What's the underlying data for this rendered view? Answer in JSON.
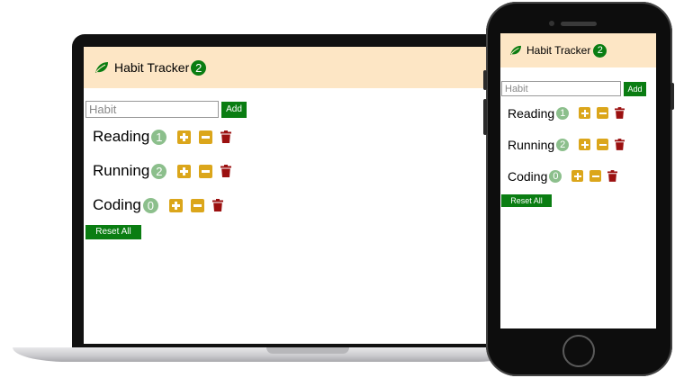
{
  "app": {
    "title": "Habit Tracker",
    "total_count": "2",
    "input_placeholder": "Habit",
    "add_label": "Add",
    "reset_label": "Reset All",
    "habits": [
      {
        "name": "Reading",
        "count": "1"
      },
      {
        "name": "Running",
        "count": "2"
      },
      {
        "name": "Coding",
        "count": "0"
      }
    ]
  },
  "icons": {
    "brand": "leaf-icon",
    "increment": "plus-icon",
    "decrement": "minus-icon",
    "delete": "trash-icon"
  },
  "colors": {
    "header_bg": "#fde6c5",
    "primary_green": "#0a7d12",
    "count_badge": "#8cbf8c",
    "action_yellow": "#dba61b",
    "delete_red": "#9b1010"
  }
}
